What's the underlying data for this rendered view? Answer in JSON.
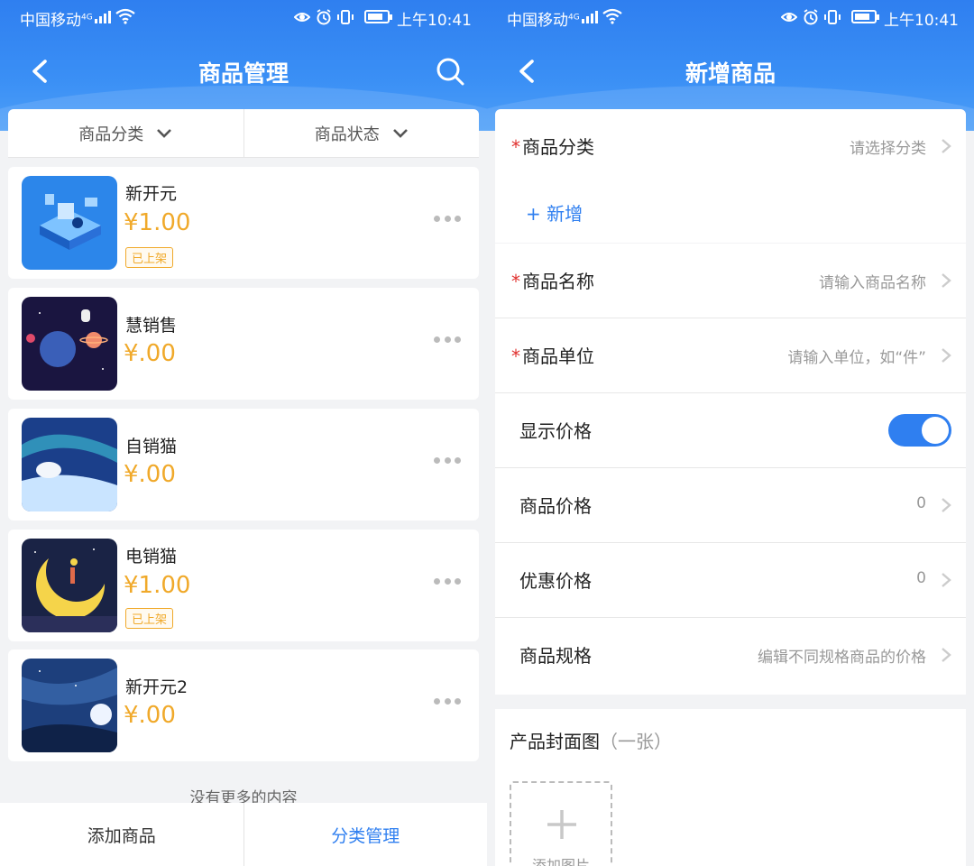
{
  "status_bar": {
    "carrier": "中国移动",
    "network": "4G",
    "time": "上午10:41"
  },
  "left": {
    "title": "商品管理",
    "filters": [
      "商品分类",
      "商品状态"
    ],
    "products": [
      {
        "name": "新开元",
        "price": "¥1.00",
        "badge": "已上架",
        "thumb": "isometric-tech"
      },
      {
        "name": "慧销售",
        "price": "¥.00",
        "badge": "",
        "thumb": "space-astronaut"
      },
      {
        "name": "自销猫",
        "price": "¥.00",
        "badge": "",
        "thumb": "aurora-bear"
      },
      {
        "name": "电销猫",
        "price": "¥1.00",
        "badge": "已上架",
        "thumb": "moon-girl"
      },
      {
        "name": "新开元2",
        "price": "¥.00",
        "badge": "",
        "thumb": "night-sky"
      }
    ],
    "no_more": "没有更多的内容",
    "bottom": {
      "add_product": "添加商品",
      "category_manage": "分类管理"
    }
  },
  "right": {
    "title": "新增商品",
    "category": {
      "label": "商品分类",
      "placeholder": "请选择分类",
      "add_new": "+ 新增"
    },
    "fields": [
      {
        "label": "商品名称",
        "value": "请输入商品名称",
        "required": true
      },
      {
        "label": "商品单位",
        "value": "请输入单位，如“件”",
        "required": true
      },
      {
        "label": "显示价格",
        "value": "",
        "required": false,
        "toggle": true,
        "toggle_on": true
      },
      {
        "label": "商品价格",
        "value": "0",
        "required": false
      },
      {
        "label": "优惠价格",
        "value": "0",
        "required": false
      },
      {
        "label": "商品规格",
        "value": "编辑不同规格商品的价格",
        "required": false
      }
    ],
    "cover": {
      "label": "产品封面图",
      "hint": "（一张）",
      "upload_text": "添加图片"
    }
  },
  "colors": {
    "accent": "#2f7ff0",
    "price": "#f0a92a",
    "required": "#e0302e"
  }
}
